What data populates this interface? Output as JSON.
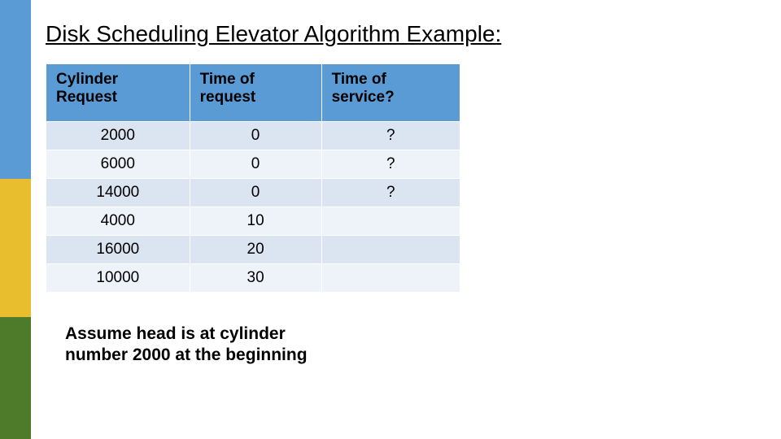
{
  "title": "Disk Scheduling Elevator Algorithm Example:",
  "columns": {
    "c0": "Cylinder Request",
    "c1": "Time of request",
    "c2": "Time of service?"
  },
  "chart_data": {
    "type": "table",
    "columns": [
      "Cylinder Request",
      "Time of request",
      "Time of service?"
    ],
    "rows": [
      {
        "cylinder": "2000",
        "t_req": "0",
        "t_svc": "?"
      },
      {
        "cylinder": "6000",
        "t_req": "0",
        "t_svc": "?"
      },
      {
        "cylinder": "14000",
        "t_req": "0",
        "t_svc": "?"
      },
      {
        "cylinder": "4000",
        "t_req": "10",
        "t_svc": ""
      },
      {
        "cylinder": "16000",
        "t_req": "20",
        "t_svc": ""
      },
      {
        "cylinder": "10000",
        "t_req": "30",
        "t_svc": ""
      }
    ]
  },
  "note": "Assume head is at cylinder number 2000 at the beginning",
  "colors": {
    "accent": "#5b9bd5",
    "gold": "#e8bd2e",
    "green": "#4e7b2a"
  }
}
